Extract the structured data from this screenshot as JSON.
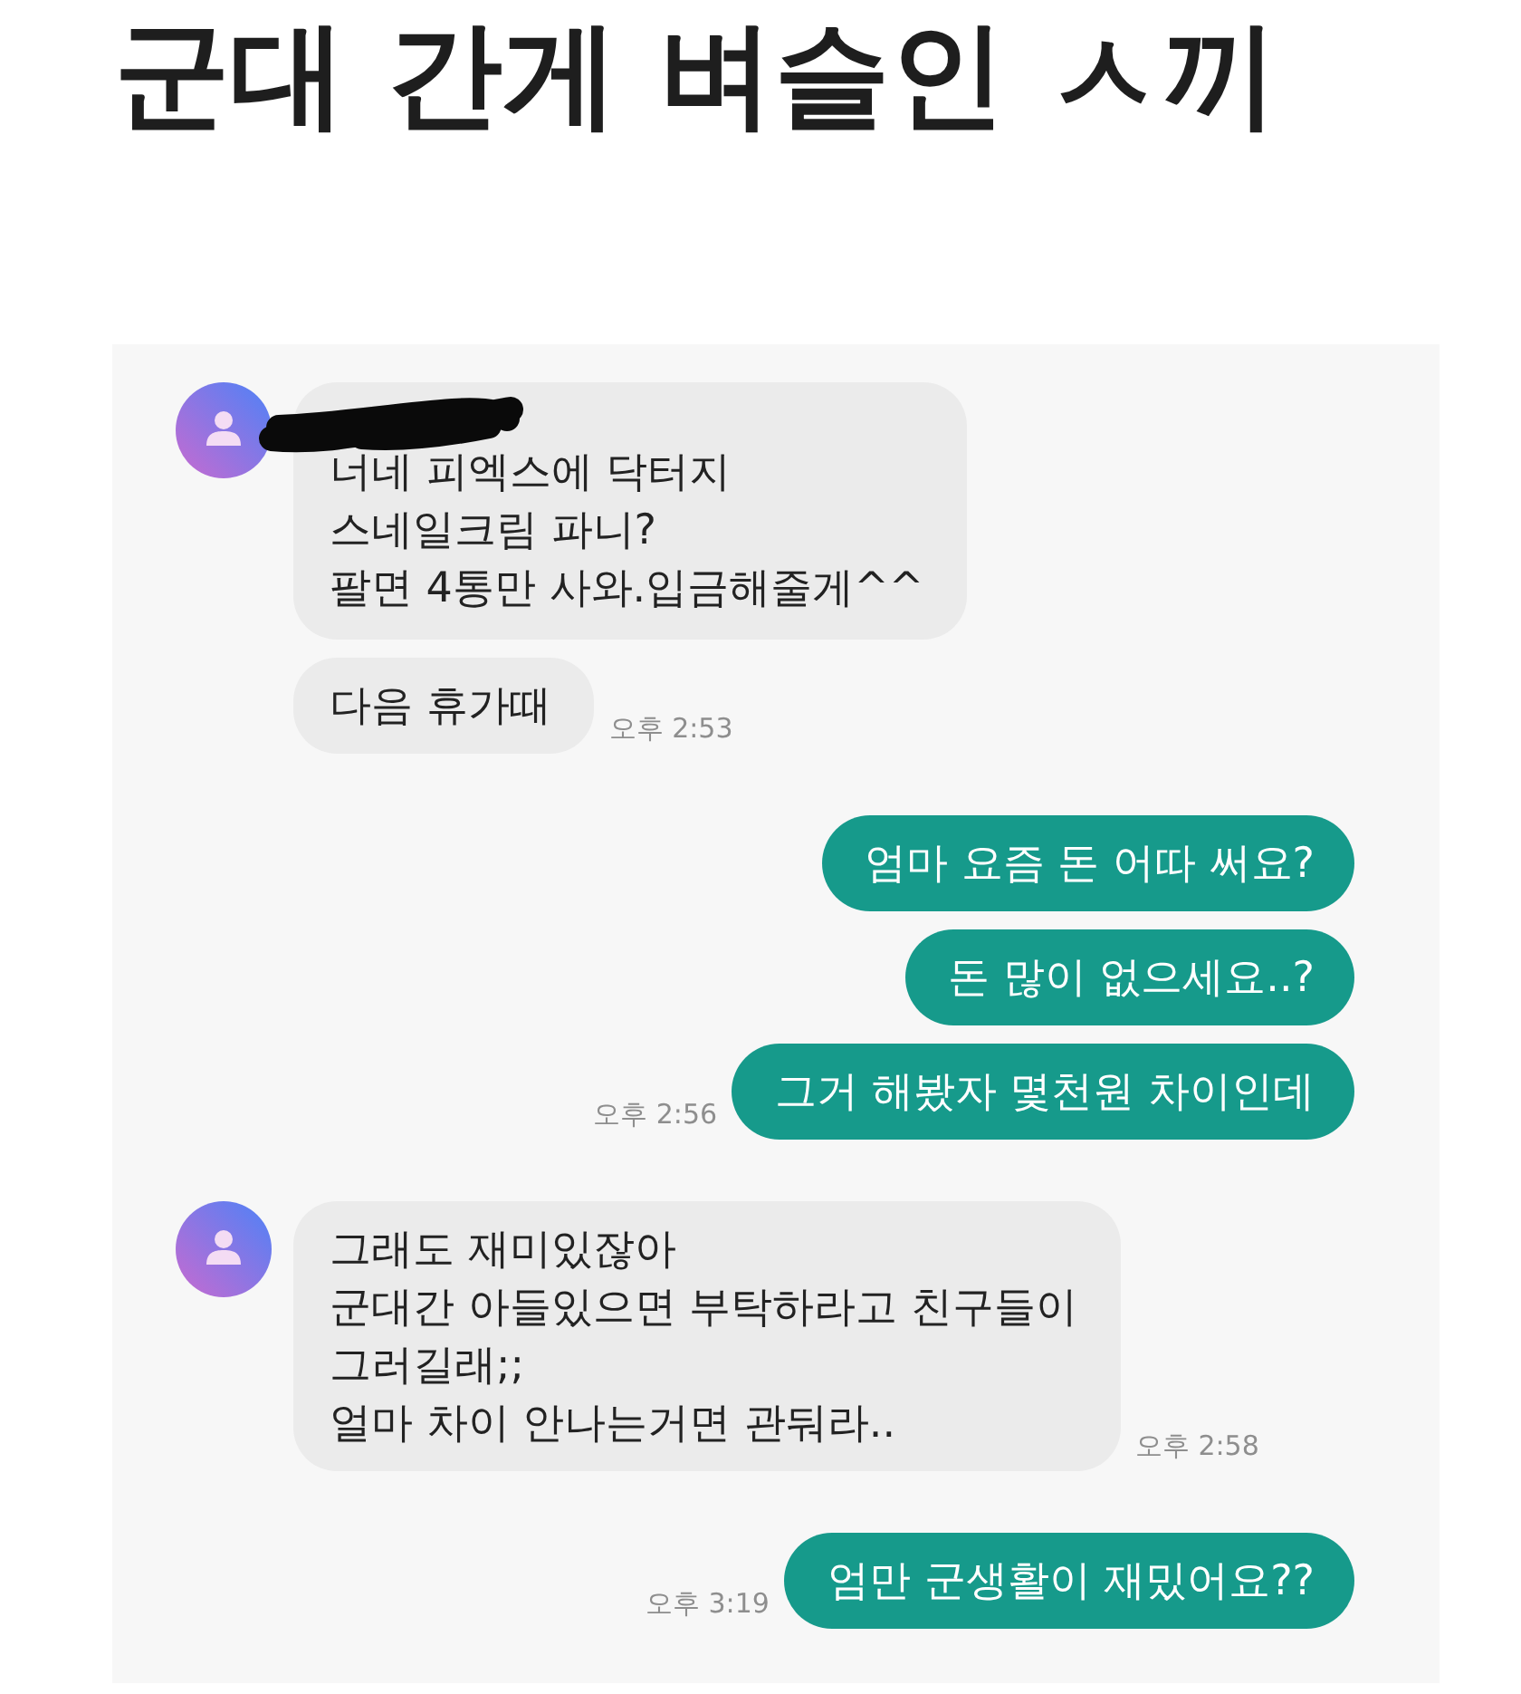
{
  "title": "군대 간게 벼슬인 ㅅ끼",
  "chat": {
    "groups": [
      {
        "kind": "received",
        "name_redacted": true,
        "messages": [
          "너네 피엑스에 닥터지\n스네일크림 파니?\n팔면 4통만 사와.입금해줄게^^",
          "다음 휴가때"
        ],
        "time": "오후 2:53"
      },
      {
        "kind": "sent",
        "messages": [
          "엄마 요즘 돈 어따 써요?",
          "돈 많이 없으세요..?",
          "그거 해봤자 몇천원 차이인데"
        ],
        "time": "오후 2:56"
      },
      {
        "kind": "received",
        "name_redacted": false,
        "messages": [
          "그래도 재미있잖아\n군대간 아들있으면 부탁하라고 친구들이\n그러길래;;\n얼마 차이 안나는거면 관둬라.."
        ],
        "time": "오후 2:58"
      },
      {
        "kind": "sent",
        "messages": [
          "엄만 군생활이 재밌어요??"
        ],
        "time": "오후 3:19"
      }
    ]
  }
}
